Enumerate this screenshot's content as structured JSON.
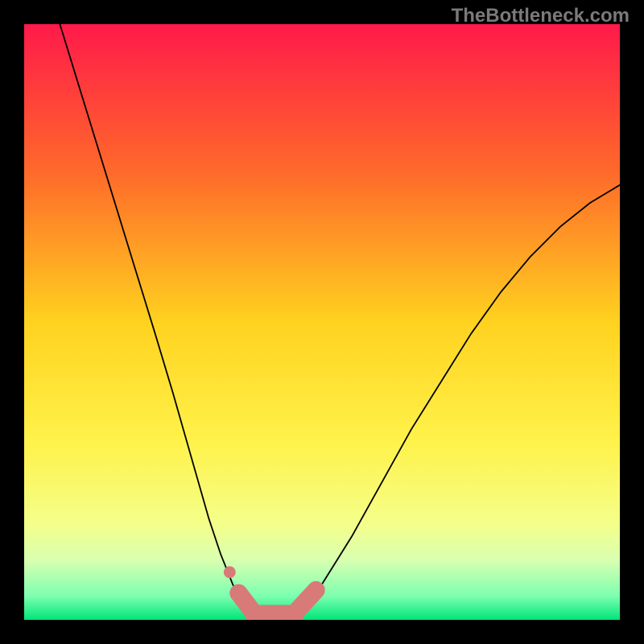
{
  "watermark": "TheBottleneck.com",
  "chart_data": {
    "type": "line",
    "title": "",
    "xlabel": "",
    "ylabel": "",
    "xlim": [
      0,
      100
    ],
    "ylim": [
      0,
      100
    ],
    "gradient_stops": [
      {
        "offset": 0,
        "color": "#ff1a4a"
      },
      {
        "offset": 25,
        "color": "#ff6a2a"
      },
      {
        "offset": 50,
        "color": "#ffd21f"
      },
      {
        "offset": 70,
        "color": "#fff24a"
      },
      {
        "offset": 84,
        "color": "#f4ff8a"
      },
      {
        "offset": 90,
        "color": "#d8ffb0"
      },
      {
        "offset": 96,
        "color": "#7dffb0"
      },
      {
        "offset": 100,
        "color": "#00e57a"
      }
    ],
    "series": [
      {
        "name": "left-branch",
        "x": [
          6,
          10,
          14,
          18,
          22,
          25,
          27,
          29,
          31,
          33,
          35,
          36.5,
          38
        ],
        "values": [
          100,
          87,
          74,
          61,
          48,
          38,
          31,
          24,
          17,
          11,
          6,
          3,
          1
        ]
      },
      {
        "name": "valley-floor",
        "x": [
          38,
          40,
          42,
          44,
          46
        ],
        "values": [
          1,
          0.5,
          0.4,
          0.6,
          1.3
        ]
      },
      {
        "name": "right-branch",
        "x": [
          46,
          50,
          55,
          60,
          65,
          70,
          75,
          80,
          85,
          90,
          95,
          100
        ],
        "values": [
          1.3,
          6,
          14,
          23,
          32,
          40,
          48,
          55,
          61,
          66,
          70,
          73
        ]
      }
    ],
    "markers": [
      {
        "name": "left-dot",
        "x": 34.5,
        "y": 8,
        "r": 1.0,
        "shape": "dot"
      },
      {
        "name": "left-pill",
        "x0": 36,
        "x1": 38.5,
        "y0": 4.5,
        "y1": 1.2,
        "r": 1.5,
        "shape": "pill"
      },
      {
        "name": "floor-pill",
        "x0": 38.5,
        "x1": 45.5,
        "y0": 1.0,
        "y1": 1.0,
        "r": 1.5,
        "shape": "pill"
      },
      {
        "name": "right-pill",
        "x0": 45.5,
        "x1": 49,
        "y0": 1.2,
        "y1": 5.0,
        "r": 1.5,
        "shape": "pill"
      }
    ],
    "marker_color": "#d87a78",
    "curve_color": "#000000"
  }
}
